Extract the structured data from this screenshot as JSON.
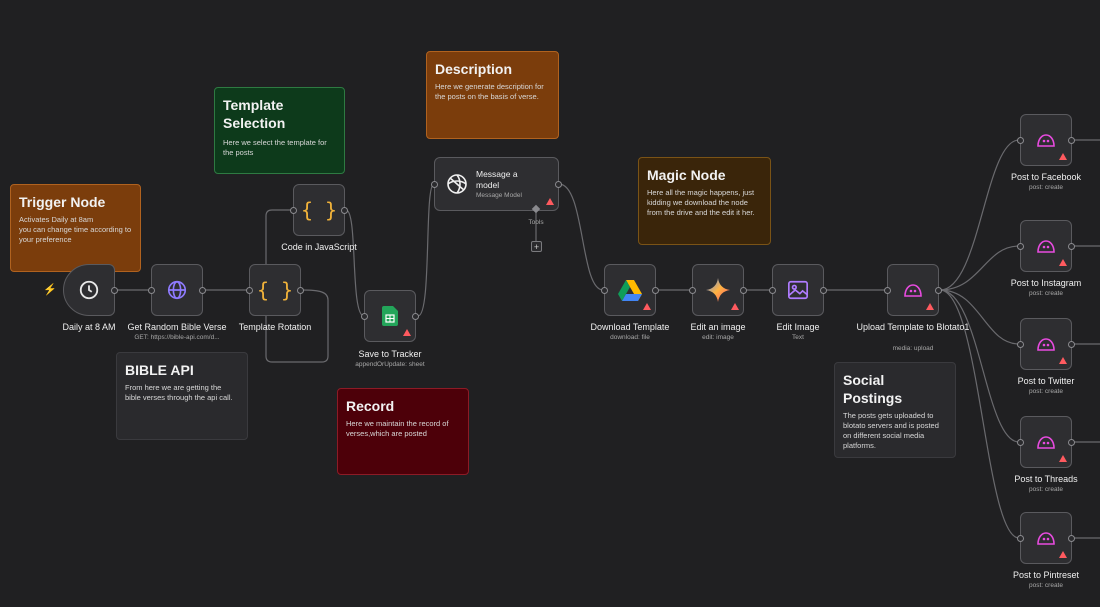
{
  "stickies": {
    "trigger": {
      "title": "Trigger Node",
      "body": "Activates Daily at 8am\nyou can change time according to your preference"
    },
    "template_selection": {
      "title": "Template Selection",
      "body": "Here we select the template for the posts"
    },
    "description": {
      "title": "Description",
      "body": "Here we generate description for the posts on the basis of verse."
    },
    "magic": {
      "title": "Magic Node",
      "body": "Here all the magic happens, just kidding we download the node from the drive and the edit it her."
    },
    "bible": {
      "title": "BIBLE API",
      "body": "From here we are getting the bible verses through the api call."
    },
    "record": {
      "title": "Record",
      "body": "Here we maintain the record of verses,which are posted"
    },
    "social": {
      "title": "Social Postings",
      "body": "The posts gets uploaded to blotato servers and is posted on different social media platforms."
    }
  },
  "nodes": {
    "daily": {
      "label": "Daily at 8 AM",
      "icon": "clock-icon"
    },
    "bible_verse": {
      "label": "Get Random Bible Verse",
      "sub": "GET: https://bible-api.com/d...",
      "icon": "globe-icon"
    },
    "template_rotation": {
      "label": "Template Rotation",
      "icon": "code-icon"
    },
    "code_js": {
      "label": "Code in JavaScript",
      "icon": "code-icon"
    },
    "save_tracker": {
      "label": "Save to Tracker",
      "sub": "appendOrUpdate: sheet",
      "icon": "sheets-icon"
    },
    "message_model": {
      "label": "Message a model",
      "sub": "Message Model",
      "tools": "Tools",
      "icon": "openai-icon"
    },
    "download_template": {
      "label": "Download Template",
      "sub": "download: file",
      "icon": "drive-icon"
    },
    "edit_an_image": {
      "label": "Edit an image",
      "sub": "edit: image",
      "icon": "gemini-icon"
    },
    "edit_image": {
      "label": "Edit Image",
      "sub": "Text",
      "icon": "image-icon"
    },
    "upload_template": {
      "label": "Upload Template to Blotato1",
      "sub": "media: upload",
      "icon": "blotato-icon"
    },
    "facebook": {
      "label": "Post to Facebook",
      "sub": "post: create",
      "icon": "blotato-icon"
    },
    "instagram": {
      "label": "Post to Instagram",
      "sub": "post: create",
      "icon": "blotato-icon"
    },
    "twitter": {
      "label": "Post to Twitter",
      "sub": "post: create",
      "icon": "blotato-icon"
    },
    "threads": {
      "label": "Post to Threads",
      "sub": "post: create",
      "icon": "blotato-icon"
    },
    "pintreset": {
      "label": "Post to Pintreset",
      "sub": "post: create",
      "icon": "blotato-icon"
    }
  },
  "colors": {
    "canvas": "#202022",
    "edge": "#6a6a6e",
    "warning": "#ff5a5f",
    "trigger_bolt": "#ff6d2e"
  }
}
